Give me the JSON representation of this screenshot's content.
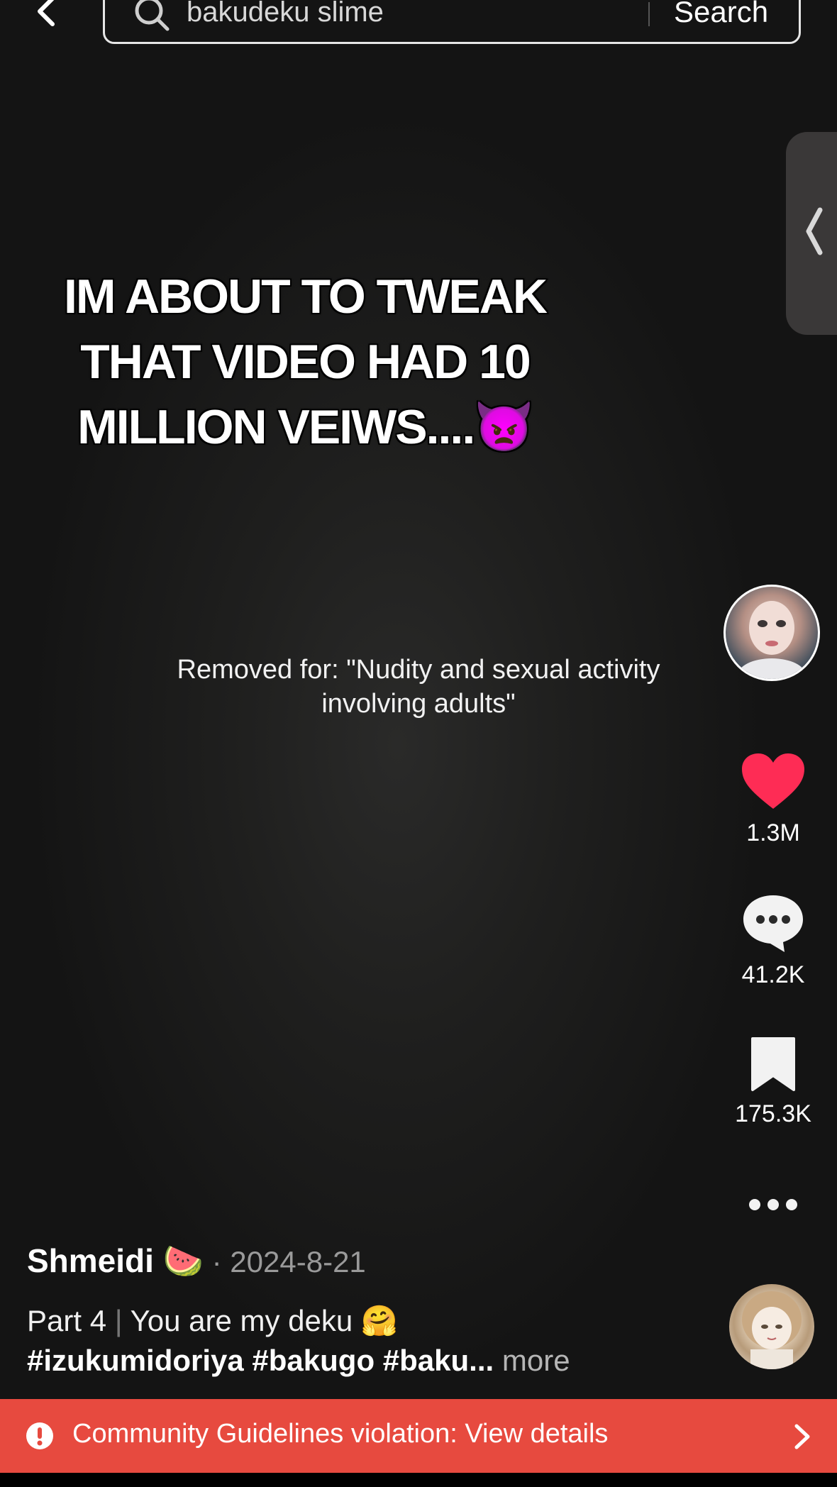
{
  "search": {
    "query": "bakudeku slime",
    "button_label": "Search"
  },
  "video": {
    "caption_lines": [
      "IM ABOUT TO TWEAK",
      "THAT VIDEO HAD 10",
      "MILLION VEIWS....👿"
    ],
    "removed_line1": "Removed for: \"Nudity and sexual activity",
    "removed_line2": "involving adults\""
  },
  "actions": {
    "likes": "1.3M",
    "comments": "41.2K",
    "saves": "175.3K"
  },
  "post": {
    "author": "Shmeidi 🍉",
    "date": " · 2024-8-21",
    "part": "Part 4",
    "separator": " | ",
    "description": "You are my deku 🤗",
    "hashtags": "#izukumidoriya #bakugo #baku...",
    "more_label": " more"
  },
  "banner": {
    "text": "Community Guidelines violation: View details"
  },
  "colors": {
    "like_red": "#fe2c55",
    "banner_red": "#e74a3f"
  },
  "icons": [
    "back-arrow-icon",
    "search-icon",
    "chevron-left-icon",
    "heart-icon",
    "comment-icon",
    "bookmark-icon",
    "more-dots-icon",
    "alert-icon",
    "chevron-right-icon"
  ]
}
